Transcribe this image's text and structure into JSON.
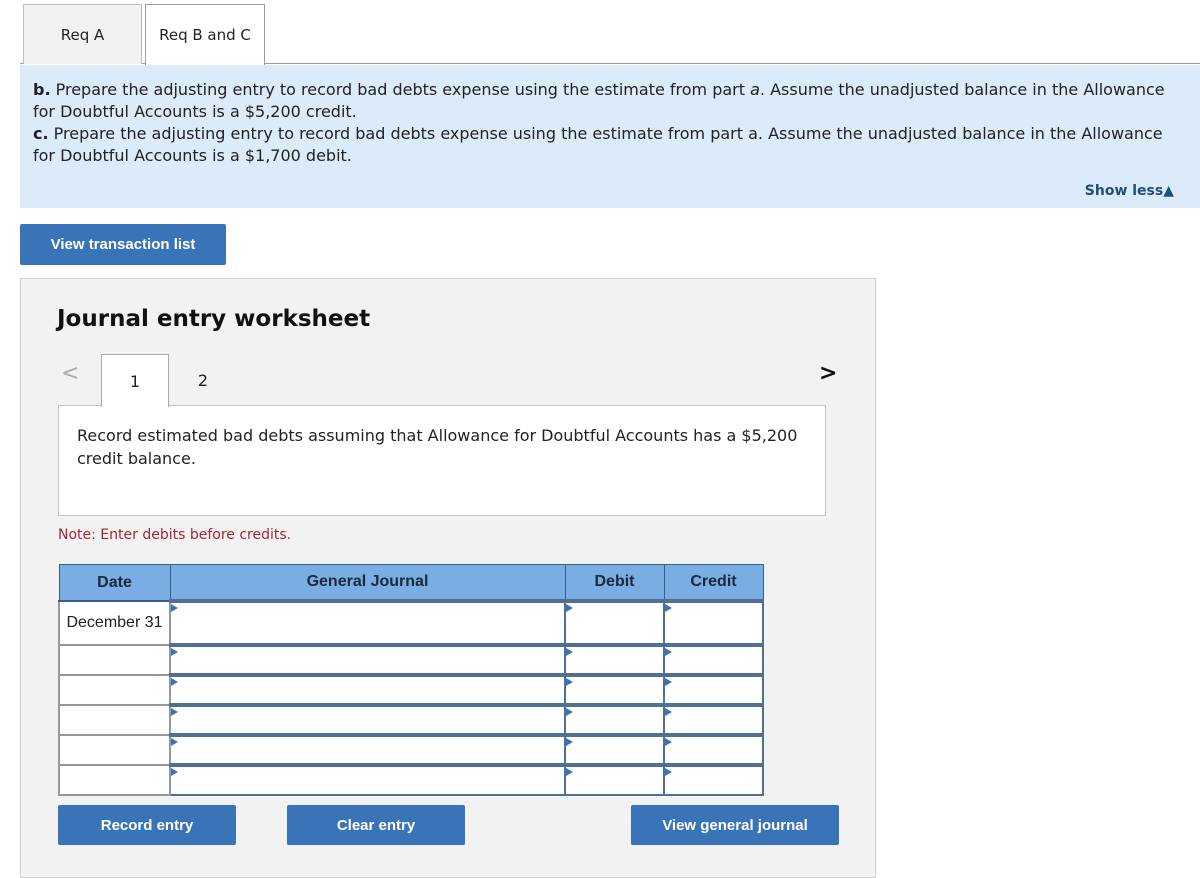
{
  "tabs": [
    {
      "label": "Req A",
      "active": false
    },
    {
      "label": "Req B and C",
      "active": true
    }
  ],
  "prompt": {
    "b_label": "b.",
    "b_text": " Prepare the adjusting entry to record bad debts expense using the estimate from part ",
    "b_italic": "a",
    "b_text2": ". Assume the unadjusted balance in the Allowance for Doubtful Accounts is a $5,200 credit.",
    "c_label": "c.",
    "c_text": " Prepare the adjusting entry to record bad debts expense using the estimate from part a. Assume the unadjusted balance in the Allowance for Doubtful Accounts is a $1,700 debit.",
    "show_less": "Show less",
    "show_less_icon": "▲"
  },
  "view_transaction_list": "View transaction list",
  "worksheet": {
    "title": "Journal entry worksheet",
    "prev_icon": "<",
    "next_icon": ">",
    "pages": [
      "1",
      "2"
    ],
    "active_page": "1",
    "description": "Record estimated bad debts assuming that Allowance for Doubtful Accounts has a $5,200 credit balance.",
    "note": "Note: Enter debits before credits.",
    "table": {
      "headers": [
        "Date",
        "General Journal",
        "Debit",
        "Credit"
      ],
      "rows": [
        {
          "date": "December 31",
          "account": "",
          "debit": "",
          "credit": ""
        },
        {
          "date": "",
          "account": "",
          "debit": "",
          "credit": ""
        },
        {
          "date": "",
          "account": "",
          "debit": "",
          "credit": ""
        },
        {
          "date": "",
          "account": "",
          "debit": "",
          "credit": ""
        },
        {
          "date": "",
          "account": "",
          "debit": "",
          "credit": ""
        },
        {
          "date": "",
          "account": "",
          "debit": "",
          "credit": ""
        }
      ]
    },
    "buttons": {
      "record": "Record entry",
      "clear": "Clear entry",
      "view_general_journal": "View general journal"
    }
  }
}
